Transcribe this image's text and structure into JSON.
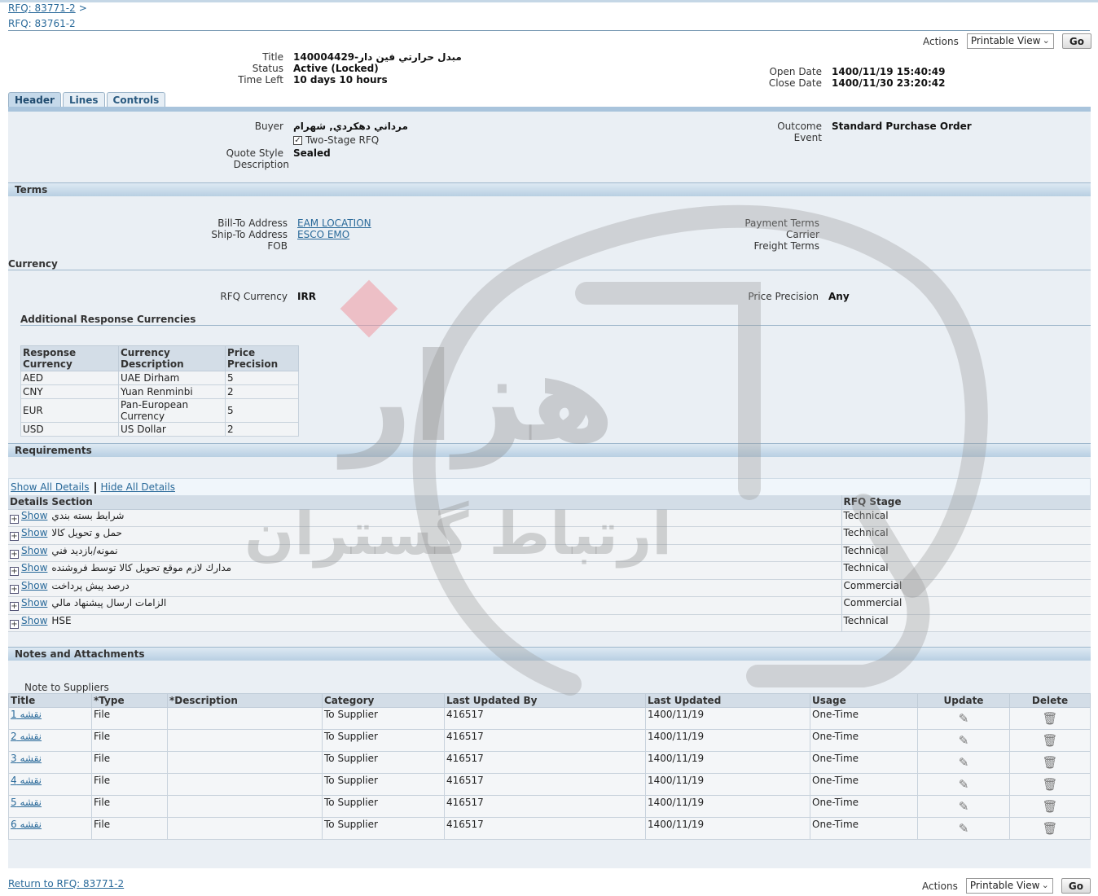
{
  "breadcrumb": {
    "link": "RFQ: 83771-2",
    "sep": ">"
  },
  "page_title": "RFQ: 83761-2",
  "actions": {
    "label": "Actions",
    "selected": "Printable View",
    "go": "Go"
  },
  "summary": {
    "title_label": "Title",
    "title_value": "مبدل حرارتي فين دار-140004429",
    "status_label": "Status",
    "status_value": "Active (Locked)",
    "time_left_label": "Time Left",
    "time_left_value": "10 days 10 hours",
    "open_date_label": "Open Date",
    "open_date_value": "1400/11/19 15:40:49",
    "close_date_label": "Close Date",
    "close_date_value": "1400/11/30 23:20:42"
  },
  "tabs": [
    "Header",
    "Lines",
    "Controls"
  ],
  "header": {
    "buyer_label": "Buyer",
    "buyer_value": "مرداني دهكردي, شهرام",
    "two_stage_label": "Two-Stage RFQ",
    "quote_style_label": "Quote Style",
    "quote_style_value": "Sealed",
    "description_label": "Description",
    "outcome_label": "Outcome",
    "outcome_value": "Standard Purchase Order",
    "event_label": "Event"
  },
  "terms": {
    "heading": "Terms",
    "bill_to_label": "Bill-To Address",
    "bill_to_value": "EAM LOCATION",
    "ship_to_label": "Ship-To Address",
    "ship_to_value": "ESCO EMO",
    "fob_label": "FOB",
    "payment_terms_label": "Payment Terms",
    "carrier_label": "Carrier",
    "freight_terms_label": "Freight Terms"
  },
  "currency": {
    "heading": "Currency",
    "rfq_currency_label": "RFQ Currency",
    "rfq_currency_value": "IRR",
    "price_precision_label": "Price Precision",
    "price_precision_value": "Any",
    "additional_heading": "Additional Response Currencies",
    "columns": [
      "Response Currency",
      "Currency Description",
      "Price Precision"
    ],
    "rows": [
      [
        "AED",
        "UAE Dirham",
        "5"
      ],
      [
        "CNY",
        "Yuan Renminbi",
        "2"
      ],
      [
        "EUR",
        "Pan-European Currency",
        "5"
      ],
      [
        "USD",
        "US Dollar",
        "2"
      ]
    ]
  },
  "requirements": {
    "heading": "Requirements",
    "show_all": "Show All Details",
    "hide_all": "Hide All Details",
    "columns": [
      "Details",
      "Section",
      "RFQ Stage"
    ],
    "show_label": "Show",
    "rows": [
      [
        "شرايط بسته بندي",
        "Technical"
      ],
      [
        "حمل و تحويل كالا",
        "Technical"
      ],
      [
        "نمونه/بازديد فني",
        "Technical"
      ],
      [
        "مدارك لازم موقع تحويل كالا توسط فروشنده",
        "Technical"
      ],
      [
        "درصد پيش پرداخت",
        "Commercial"
      ],
      [
        "الزامات ارسال پيشنهاد مالي",
        "Commercial"
      ],
      [
        "HSE",
        "Technical"
      ]
    ]
  },
  "attachments": {
    "heading": "Notes and Attachments",
    "note_label": "Note to Suppliers",
    "columns": [
      "Title",
      "*Type",
      "*Description",
      "Category",
      "Last Updated By",
      "Last Updated",
      "Usage",
      "Update",
      "Delete"
    ],
    "rows": [
      [
        "نقشه 1",
        "File",
        "",
        "To Supplier",
        "416517",
        "1400/11/19",
        "One-Time"
      ],
      [
        "نقشه 2",
        "File",
        "",
        "To Supplier",
        "416517",
        "1400/11/19",
        "One-Time"
      ],
      [
        "نقشه 3",
        "File",
        "",
        "To Supplier",
        "416517",
        "1400/11/19",
        "One-Time"
      ],
      [
        "نقشه 4",
        "File",
        "",
        "To Supplier",
        "416517",
        "1400/11/19",
        "One-Time"
      ],
      [
        "نقشه 5",
        "File",
        "",
        "To Supplier",
        "416517",
        "1400/11/19",
        "One-Time"
      ],
      [
        "نقشه 6",
        "File",
        "",
        "To Supplier",
        "416517",
        "1400/11/19",
        "One-Time"
      ]
    ]
  },
  "footer": {
    "return_link": "Return to RFQ: 83771-2"
  },
  "watermark": {
    "text": "ارتباط گستران",
    "logo": "هزار"
  }
}
